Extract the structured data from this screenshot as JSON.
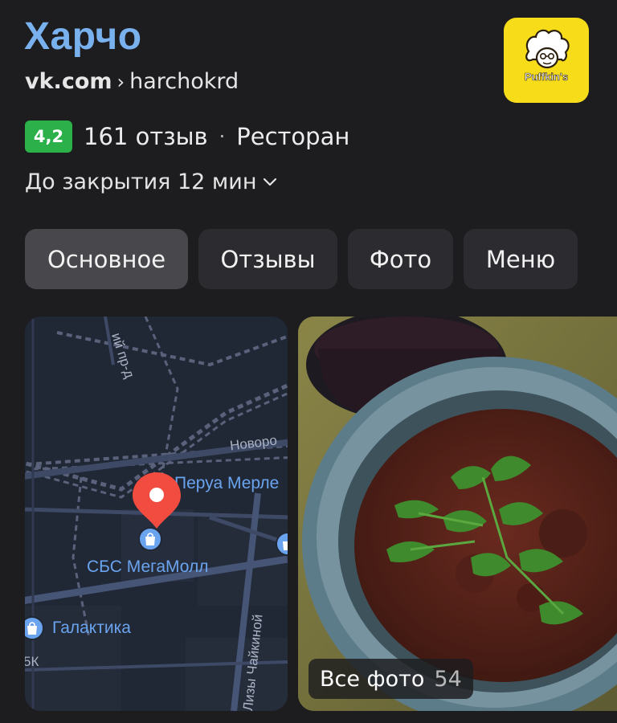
{
  "place": {
    "title": "Харчо",
    "url_domain": "vk.com",
    "url_separator": "›",
    "url_path": "harchokrd",
    "rating": "4,2",
    "reviews": "161 отзыв",
    "dot": "·",
    "category": "Ресторан",
    "hours": "До закрытия 12 мин",
    "logo_text": "Puffkin's"
  },
  "tabs": [
    {
      "label": "Основное",
      "active": true
    },
    {
      "label": "Отзывы",
      "active": false
    },
    {
      "label": "Фото",
      "active": false
    },
    {
      "label": "Меню",
      "active": false
    }
  ],
  "map": {
    "labels": {
      "street_top": "ий пр-д",
      "street_novoro": "Новоро",
      "street_chaikinoy": "Лизы Чайкиной",
      "peru_merle": "Перуа Мерле",
      "megamoll": "СБС МегаМолл",
      "galaktika": "Галактика",
      "edge_text": "5К"
    }
  },
  "photos": {
    "label": "Все фото",
    "count": "54"
  },
  "colors": {
    "title": "#79b1ee",
    "rating_green": "#2bb04a",
    "logo_yellow": "#f7dc1a",
    "pin_red": "#f24b3f",
    "map_poi_blue": "#6aa4ef"
  },
  "icons": {
    "hours_toggle": "chevron-down-icon",
    "map_pin": "location-pin-icon",
    "poi": "shopping-bag-icon"
  }
}
